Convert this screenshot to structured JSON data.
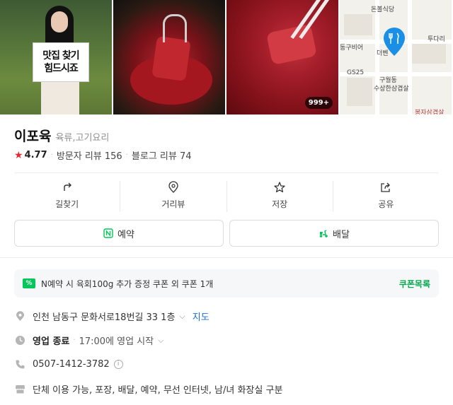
{
  "photos": {
    "sign_line1": "맛집 찾기",
    "sign_line2": "힘드시죠",
    "photo_count": "999+"
  },
  "map": {
    "labels": [
      "돈볼식당",
      "투다리",
      "동구비어",
      "더벤",
      "GS25",
      "구월동",
      "수상한삼겹살",
      "봉자삼겹살"
    ]
  },
  "place": {
    "name": "이포육",
    "category": "육류,고기요리",
    "rating": "4.77",
    "visitor_reviews": "방문자 리뷰 156",
    "blog_reviews": "블로그 리뷰 74"
  },
  "actions": {
    "directions": "길찾기",
    "street_view": "거리뷰",
    "save": "저장",
    "share": "공유"
  },
  "buttons": {
    "reserve": "예약",
    "delivery": "배달"
  },
  "coupon": {
    "text": "N예약 시 육회100g 추가 증정 쿠폰 외 쿠폰 1개",
    "link": "쿠폰목록"
  },
  "info": {
    "address": "인천 남동구 문화서로18번길 33 1층",
    "map_link": "지도",
    "hours_status": "영업 종료",
    "hours_detail": "17:00에 영업 시작",
    "phone": "0507-1412-3782",
    "amenities": "단체 이용 가능, 포장, 배달, 예약, 무선 인터넷, 남/녀 화장실 구분"
  },
  "colors": {
    "accent_green": "#03c75a",
    "star_red": "#e8272e",
    "link_blue": "#1b6fd8",
    "map_pin_blue": "#1a8fe6"
  },
  "icons": [
    "direction-arrow-icon",
    "pin-outline-icon",
    "star-outline-icon",
    "share-icon",
    "naver-reserve-icon",
    "delivery-scooter-icon",
    "coupon-icon",
    "location-icon",
    "clock-icon",
    "phone-icon",
    "store-icon"
  ]
}
